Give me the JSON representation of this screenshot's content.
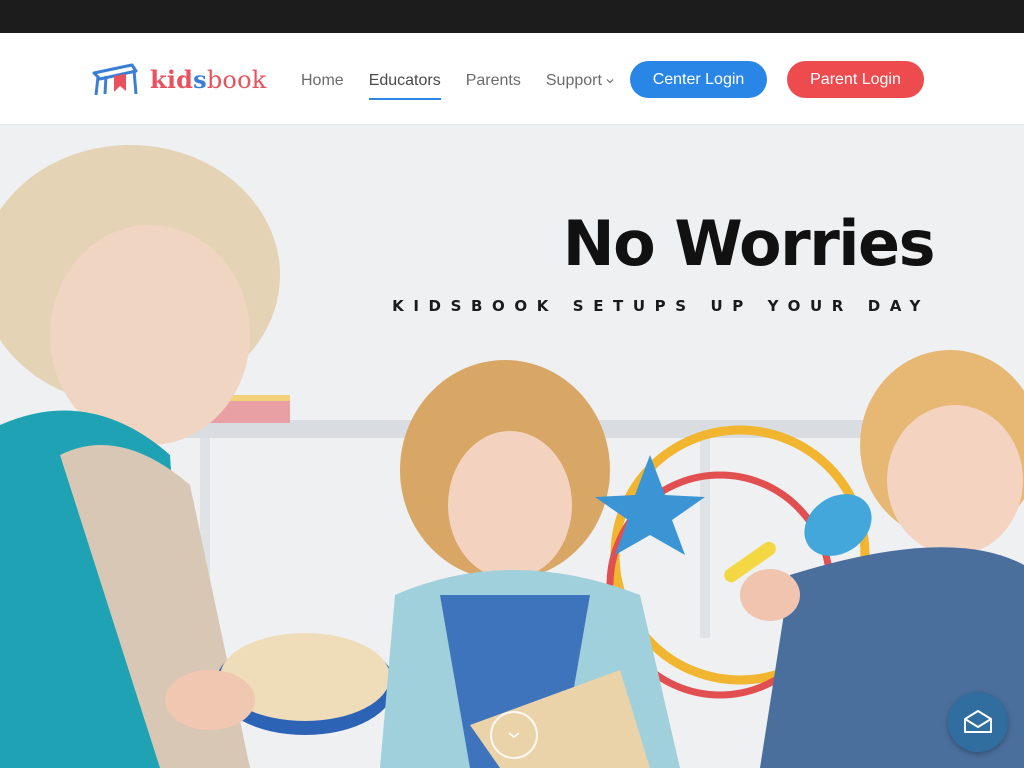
{
  "header": {
    "logo": {
      "part1": "kid",
      "part2": "s",
      "part3": "book"
    },
    "nav": [
      {
        "label": "Home"
      },
      {
        "label": "Educators"
      },
      {
        "label": "Parents"
      },
      {
        "label": "Support"
      }
    ],
    "center_login": "Center Login",
    "parent_login": "Parent Login"
  },
  "hero": {
    "title": "No Worries",
    "subtitle": "KIDSBOOK SETUPS UP YOUR DAY"
  },
  "icons": {
    "scroll": "chevron-down-icon",
    "mail": "mail-icon",
    "support_dropdown": "chevron-down-icon"
  },
  "colors": {
    "center_login": "#2a86e6",
    "parent_login": "#ee4b4f",
    "topbar": "#1c1c1c",
    "nav_active_underline": "#2d87e8",
    "mail_button": "#2f6e9e"
  }
}
